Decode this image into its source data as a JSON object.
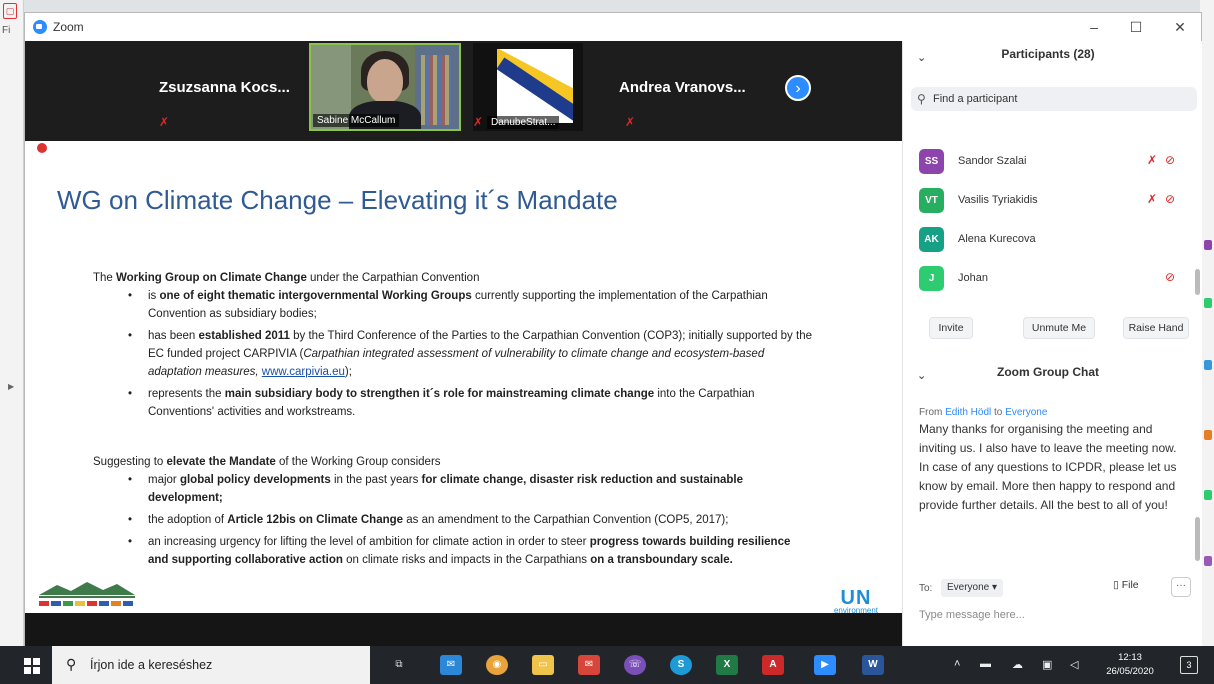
{
  "window": {
    "title": "Zoom",
    "minimize": "–",
    "maximize": "☐",
    "close": "✕"
  },
  "left_app": {
    "fi_label": "Fi"
  },
  "video_strip": {
    "tiles": [
      {
        "name": "Zsuzsanna  Kocs...",
        "muted": true
      },
      {
        "name": "Sabine McCallum",
        "muted": false
      },
      {
        "name": "DanubeStrat...",
        "muted": true
      },
      {
        "name": "Andrea  Vranovs...",
        "muted": true
      }
    ],
    "next_label": "›"
  },
  "slide": {
    "title": "WG on Climate Change – Elevating it´s Mandate",
    "intro_pre": "The ",
    "intro_bold": "Working Group on Climate Change",
    "intro_post": " under the Carpathian Convention",
    "b1_pre": "is ",
    "b1_bold": "one of eight thematic intergovernmental Working Groups",
    "b1_post": " currently supporting the implementation of the Carpathian Convention as subsidiary bodies;",
    "b2_pre": "has been ",
    "b2_bold": "established 2011",
    "b2_mid": " by the Third Conference of the Parties to the Carpathian Convention (COP3); initially supported by the EC funded project CARPIVIA (",
    "b2_ital": "Carpathian integrated assessment of vulnerability to climate change and ecosystem-based adaptation measures, ",
    "b2_link": "www.carpivia.eu",
    "b2_end": ");",
    "b3_pre": "represents the ",
    "b3_bold": "main subsidiary body to strengthen it´s role for mainstreaming climate change",
    "b3_post": " into the Carpathian Conventions' activities and workstreams.",
    "s2_pre": "Suggesting to ",
    "s2_bold": "elevate the Mandate",
    "s2_post": " of the Working Group considers",
    "c1_pre": "major ",
    "c1_bold1": "global policy developments",
    "c1_mid": " in the past years ",
    "c1_bold2": "for climate change, disaster risk reduction and sustainable development;",
    "c2_pre": "the adoption of ",
    "c2_bold": "Article 12bis on Climate Change",
    "c2_post": " as an amendment to the Carpathian Convention (COP5, 2017);",
    "c3_pre": "an increasing urgency for lifting the level of ambition for climate action in order to steer ",
    "c3_bold1": "progress towards building resilience and supporting collaborative action",
    "c3_mid": " on climate risks and impacts in the Carpathians ",
    "c3_bold2": "on a transboundary scale.",
    "unep_main": "UN",
    "unep_sub": "environment"
  },
  "participants": {
    "header": "Participants (28)",
    "search_placeholder": "Find a participant",
    "list": [
      {
        "initials": "SS",
        "name": "Sandor Szalai",
        "color": "#8e44ad",
        "mic_muted": true,
        "video_off": true
      },
      {
        "initials": "VT",
        "name": "Vasilis Tyriakidis",
        "color": "#27ae60",
        "mic_muted": true,
        "video_off": true
      },
      {
        "initials": "AK",
        "name": "Alena Kurecova",
        "color": "#16a085",
        "mic_muted": false,
        "video_off": false
      },
      {
        "initials": "J",
        "name": "Johan",
        "color": "#2ecc71",
        "mic_muted": false,
        "video_off": true
      }
    ],
    "buttons": {
      "invite": "Invite",
      "unmute": "Unmute Me",
      "raise": "Raise Hand"
    }
  },
  "chat": {
    "header": "Zoom Group Chat",
    "from_prefix": "From ",
    "from_name": "Edith Hödl",
    "from_to": " to ",
    "from_target": "Everyone",
    "message": "Many thanks for organising the meeting and inviting us. I also have to leave the meeting now. In case of any questions to ICPDR, please let us know by email. More then happy to respond and provide further details. All the best to all of you!",
    "to_label": "To:",
    "to_value": "Everyone ▾",
    "file_label": "File",
    "more_label": "···",
    "input_placeholder": "Type message here..."
  },
  "taskbar": {
    "search_text": "Írjon ide a kereséshez",
    "time": "12:13",
    "date": "26/05/2020",
    "notification_count": "3"
  }
}
